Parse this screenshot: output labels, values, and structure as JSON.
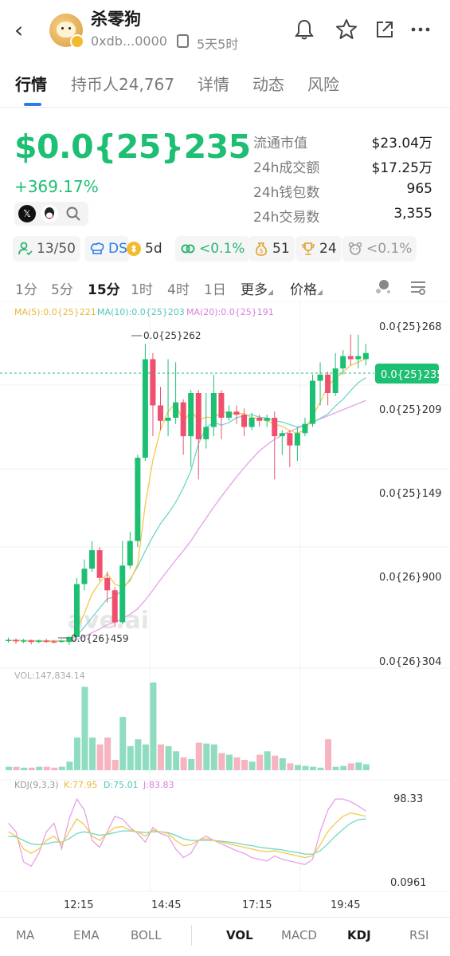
{
  "header": {
    "token_name": "杀零狗",
    "address": "0xdb...0000",
    "age": "5天5时"
  },
  "tabs": [
    {
      "label": "行情",
      "active": true
    },
    {
      "label": "持币人24,767",
      "active": false
    },
    {
      "label": "详情",
      "active": false
    },
    {
      "label": "动态",
      "active": false
    },
    {
      "label": "风险",
      "active": false
    }
  ],
  "price": {
    "value": "$0.0{25}235",
    "change": "+369.17%",
    "color": "#1dbf73"
  },
  "stats": [
    {
      "label": "流通市值",
      "value": "$23.04万"
    },
    {
      "label": "24h成交额",
      "value": "$17.25万"
    },
    {
      "label": "24h钱包数",
      "value": "965"
    },
    {
      "label": "24h交易数",
      "value": "3,355"
    }
  ],
  "badges": {
    "holders": "13/50",
    "dev": "DS",
    "chain_age": "5d",
    "top": "<0.1%",
    "bundles": "51",
    "snipers": "24",
    "insiders": "<0.1%"
  },
  "intervals": [
    "1分",
    "5分",
    "15分",
    "1时",
    "4时",
    "1日"
  ],
  "interval_active": "15分",
  "more_label": "更多",
  "price_label": "价格",
  "chart_data": {
    "type": "candlestick",
    "ma_legend": {
      "ma5": "MA(5):0.0{25}221",
      "ma10": "MA(10):0.0{25}203",
      "ma20": "MA(20):0.0{25}191"
    },
    "y_ticks": [
      "0.0{25}268",
      "0.0{25}209",
      "0.0{25}149",
      "0.0{26}900",
      "0.0{26}304"
    ],
    "current_price_label": "0.0{25}235",
    "high_label": "0.0{25}262",
    "low_label": "0.0{26}459",
    "x_ticks": [
      "12:15",
      "14:45",
      "17:15",
      "19:45"
    ],
    "vol_label": "VOL:147,834.14",
    "kdj_label": "KDJ(9,3,3)",
    "kdj_k": "K:77.95",
    "kdj_d": "D:75.01",
    "kdj_j": "J:83.83",
    "kdj_max": "98.33",
    "kdj_min": "0.0961",
    "candles": [
      {
        "o": 0.038,
        "c": 0.0395,
        "h": 0.043,
        "l": 0.035
      },
      {
        "o": 0.0395,
        "c": 0.037,
        "h": 0.042,
        "l": 0.033
      },
      {
        "o": 0.037,
        "c": 0.0385,
        "h": 0.041,
        "l": 0.034
      },
      {
        "o": 0.0385,
        "c": 0.036,
        "h": 0.04,
        "l": 0.032
      },
      {
        "o": 0.036,
        "c": 0.038,
        "h": 0.04,
        "l": 0.034
      },
      {
        "o": 0.038,
        "c": 0.037,
        "h": 0.041,
        "l": 0.0345
      },
      {
        "o": 0.037,
        "c": 0.036,
        "h": 0.0395,
        "l": 0.034
      },
      {
        "o": 0.037,
        "c": 0.038,
        "h": 0.04,
        "l": 0.035
      },
      {
        "o": 0.036,
        "c": 0.044,
        "h": 0.046,
        "l": 0.031
      },
      {
        "o": 0.044,
        "c": 0.13,
        "h": 0.14,
        "l": 0.043
      },
      {
        "o": 0.13,
        "c": 0.155,
        "h": 0.17,
        "l": 0.12
      },
      {
        "o": 0.155,
        "c": 0.185,
        "h": 0.2,
        "l": 0.15
      },
      {
        "o": 0.185,
        "c": 0.14,
        "h": 0.19,
        "l": 0.135
      },
      {
        "o": 0.14,
        "c": 0.12,
        "h": 0.15,
        "l": 0.1
      },
      {
        "o": 0.12,
        "c": 0.068,
        "h": 0.125,
        "l": 0.06
      },
      {
        "o": 0.068,
        "c": 0.16,
        "h": 0.2,
        "l": 0.065
      },
      {
        "o": 0.16,
        "c": 0.2,
        "h": 0.215,
        "l": 0.155
      },
      {
        "o": 0.2,
        "c": 0.335,
        "h": 0.34,
        "l": 0.19
      },
      {
        "o": 0.335,
        "c": 0.495,
        "h": 0.52,
        "l": 0.33
      },
      {
        "o": 0.495,
        "c": 0.42,
        "h": 0.505,
        "l": 0.37
      },
      {
        "o": 0.42,
        "c": 0.395,
        "h": 0.45,
        "l": 0.38
      },
      {
        "o": 0.395,
        "c": 0.4,
        "h": 0.495,
        "l": 0.37
      },
      {
        "o": 0.4,
        "c": 0.425,
        "h": 0.49,
        "l": 0.39
      },
      {
        "o": 0.425,
        "c": 0.37,
        "h": 0.43,
        "l": 0.34
      },
      {
        "o": 0.37,
        "c": 0.44,
        "h": 0.445,
        "l": 0.32
      },
      {
        "o": 0.44,
        "c": 0.365,
        "h": 0.445,
        "l": 0.3
      },
      {
        "o": 0.365,
        "c": 0.385,
        "h": 0.44,
        "l": 0.35
      },
      {
        "o": 0.385,
        "c": 0.44,
        "h": 0.47,
        "l": 0.37
      },
      {
        "o": 0.44,
        "c": 0.4,
        "h": 0.445,
        "l": 0.365
      },
      {
        "o": 0.4,
        "c": 0.41,
        "h": 0.42,
        "l": 0.395
      },
      {
        "o": 0.41,
        "c": 0.405,
        "h": 0.42,
        "l": 0.39
      },
      {
        "o": 0.405,
        "c": 0.385,
        "h": 0.415,
        "l": 0.37
      },
      {
        "o": 0.385,
        "c": 0.4,
        "h": 0.408,
        "l": 0.38
      },
      {
        "o": 0.4,
        "c": 0.395,
        "h": 0.405,
        "l": 0.385
      },
      {
        "o": 0.395,
        "c": 0.4,
        "h": 0.405,
        "l": 0.385
      },
      {
        "o": 0.4,
        "c": 0.37,
        "h": 0.41,
        "l": 0.3
      },
      {
        "o": 0.37,
        "c": 0.375,
        "h": 0.38,
        "l": 0.34
      },
      {
        "o": 0.375,
        "c": 0.355,
        "h": 0.38,
        "l": 0.32
      },
      {
        "o": 0.355,
        "c": 0.375,
        "h": 0.385,
        "l": 0.33
      },
      {
        "o": 0.375,
        "c": 0.39,
        "h": 0.4,
        "l": 0.37
      },
      {
        "o": 0.39,
        "c": 0.46,
        "h": 0.47,
        "l": 0.385
      },
      {
        "o": 0.46,
        "c": 0.47,
        "h": 0.49,
        "l": 0.42
      },
      {
        "o": 0.47,
        "c": 0.44,
        "h": 0.475,
        "l": 0.42
      },
      {
        "o": 0.44,
        "c": 0.48,
        "h": 0.505,
        "l": 0.435
      },
      {
        "o": 0.48,
        "c": 0.5,
        "h": 0.51,
        "l": 0.47
      },
      {
        "o": 0.5,
        "c": 0.495,
        "h": 0.535,
        "l": 0.485
      },
      {
        "o": 0.495,
        "c": 0.5,
        "h": 0.535,
        "l": 0.48
      },
      {
        "o": 0.495,
        "c": 0.505,
        "h": 0.52,
        "l": 0.485
      }
    ],
    "volumes": [
      4,
      4,
      3,
      3,
      4,
      4,
      3,
      4,
      10,
      38,
      97,
      38,
      30,
      38,
      12,
      62,
      28,
      36,
      30,
      102,
      30,
      28,
      22,
      15,
      13,
      32,
      31,
      30,
      20,
      18,
      15,
      12,
      10,
      18,
      22,
      17,
      14,
      8,
      6,
      5,
      4,
      3,
      36,
      4,
      5,
      8,
      9,
      7
    ],
    "volume_up": [
      true,
      false,
      true,
      false,
      true,
      false,
      false,
      true,
      true,
      true,
      true,
      true,
      false,
      false,
      false,
      true,
      true,
      true,
      true,
      true,
      false,
      true,
      true,
      false,
      true,
      false,
      true,
      true,
      false,
      true,
      false,
      false,
      true,
      false,
      true,
      false,
      true,
      false,
      true,
      true,
      true,
      true,
      false,
      true,
      true,
      false,
      true,
      true
    ],
    "ma5": [
      0.0385,
      0.0385,
      0.0382,
      0.0377,
      0.0374,
      0.0373,
      0.0373,
      0.0373,
      0.0386,
      0.0557,
      0.0827,
      0.1141,
      0.1325,
      0.1469,
      0.1298,
      0.125,
      0.135,
      0.1625,
      0.2585,
      0.331,
      0.381,
      0.41,
      0.424,
      0.392,
      0.411,
      0.396,
      0.401,
      0.4,
      0.409,
      0.408,
      0.406,
      0.407,
      0.4,
      0.399,
      0.395,
      0.39,
      0.386,
      0.379,
      0.375,
      0.38,
      0.403,
      0.425,
      0.452,
      0.464,
      0.474,
      0.485,
      0.49,
      0.496
    ],
    "ma10": [
      0.0385,
      0.0385,
      0.0382,
      0.038,
      0.0378,
      0.0377,
      0.0376,
      0.0375,
      0.038,
      0.0464,
      0.0603,
      0.076,
      0.0909,
      0.1061,
      0.1091,
      0.1213,
      0.1378,
      0.1585,
      0.1837,
      0.2069,
      0.2279,
      0.2444,
      0.2628,
      0.286,
      0.314,
      0.358,
      0.384,
      0.393,
      0.388,
      0.392,
      0.4,
      0.403,
      0.405,
      0.401,
      0.399,
      0.395,
      0.393,
      0.389,
      0.385,
      0.388,
      0.392,
      0.399,
      0.406,
      0.419,
      0.43,
      0.444,
      0.457,
      0.465
    ],
    "ma20": [
      0.0385,
      0.0385,
      0.0384,
      0.0383,
      0.0381,
      0.038,
      0.0379,
      0.0378,
      0.0378,
      0.04,
      0.045,
      0.051,
      0.057,
      0.064,
      0.068,
      0.074,
      0.081,
      0.09,
      0.104,
      0.12,
      0.137,
      0.153,
      0.169,
      0.184,
      0.2,
      0.219,
      0.237,
      0.255,
      0.272,
      0.288,
      0.304,
      0.319,
      0.333,
      0.346,
      0.356,
      0.365,
      0.372,
      0.378,
      0.383,
      0.388,
      0.393,
      0.398,
      0.403,
      0.408,
      0.413,
      0.418,
      0.423,
      0.428
    ],
    "kdj_k_series": [
      60,
      55,
      40,
      35,
      40,
      50,
      55,
      45,
      60,
      75,
      68,
      55,
      50,
      58,
      65,
      66,
      62,
      60,
      55,
      62,
      60,
      58,
      50,
      44,
      45,
      50,
      52,
      50,
      48,
      46,
      44,
      42,
      40,
      38,
      37,
      38,
      36,
      34,
      32,
      30,
      32,
      45,
      60,
      70,
      78,
      82,
      80,
      78
    ],
    "kdj_d_series": [
      55,
      54,
      50,
      46,
      45,
      46,
      48,
      48,
      52,
      58,
      60,
      58,
      56,
      57,
      59,
      61,
      61,
      60,
      59,
      60,
      60,
      59,
      56,
      52,
      50,
      50,
      50,
      50,
      49,
      48,
      47,
      45,
      44,
      42,
      41,
      40,
      39,
      37,
      36,
      34,
      34,
      38,
      46,
      55,
      63,
      70,
      74,
      75
    ],
    "kdj_j_series": [
      70,
      60,
      25,
      20,
      35,
      60,
      70,
      40,
      75,
      98,
      85,
      50,
      42,
      60,
      78,
      75,
      65,
      58,
      48,
      65,
      58,
      55,
      40,
      30,
      35,
      50,
      55,
      50,
      46,
      42,
      38,
      35,
      30,
      28,
      26,
      32,
      28,
      26,
      24,
      22,
      28,
      60,
      85,
      98,
      98,
      95,
      90,
      84
    ]
  },
  "indicators_left": [
    "MA",
    "EMA",
    "BOLL"
  ],
  "indicators_right": [
    "VOL",
    "MACD",
    "KDJ",
    "RSI"
  ],
  "colors": {
    "up": "#1dbf73",
    "down": "#f0506e",
    "vol_up": "#8fdcc0",
    "vol_down": "#f6b3c0",
    "ma5": "#f2c94c",
    "ma10": "#6fd6c8",
    "ma20": "#e5a0e8",
    "accent": "#2b7bf0"
  }
}
